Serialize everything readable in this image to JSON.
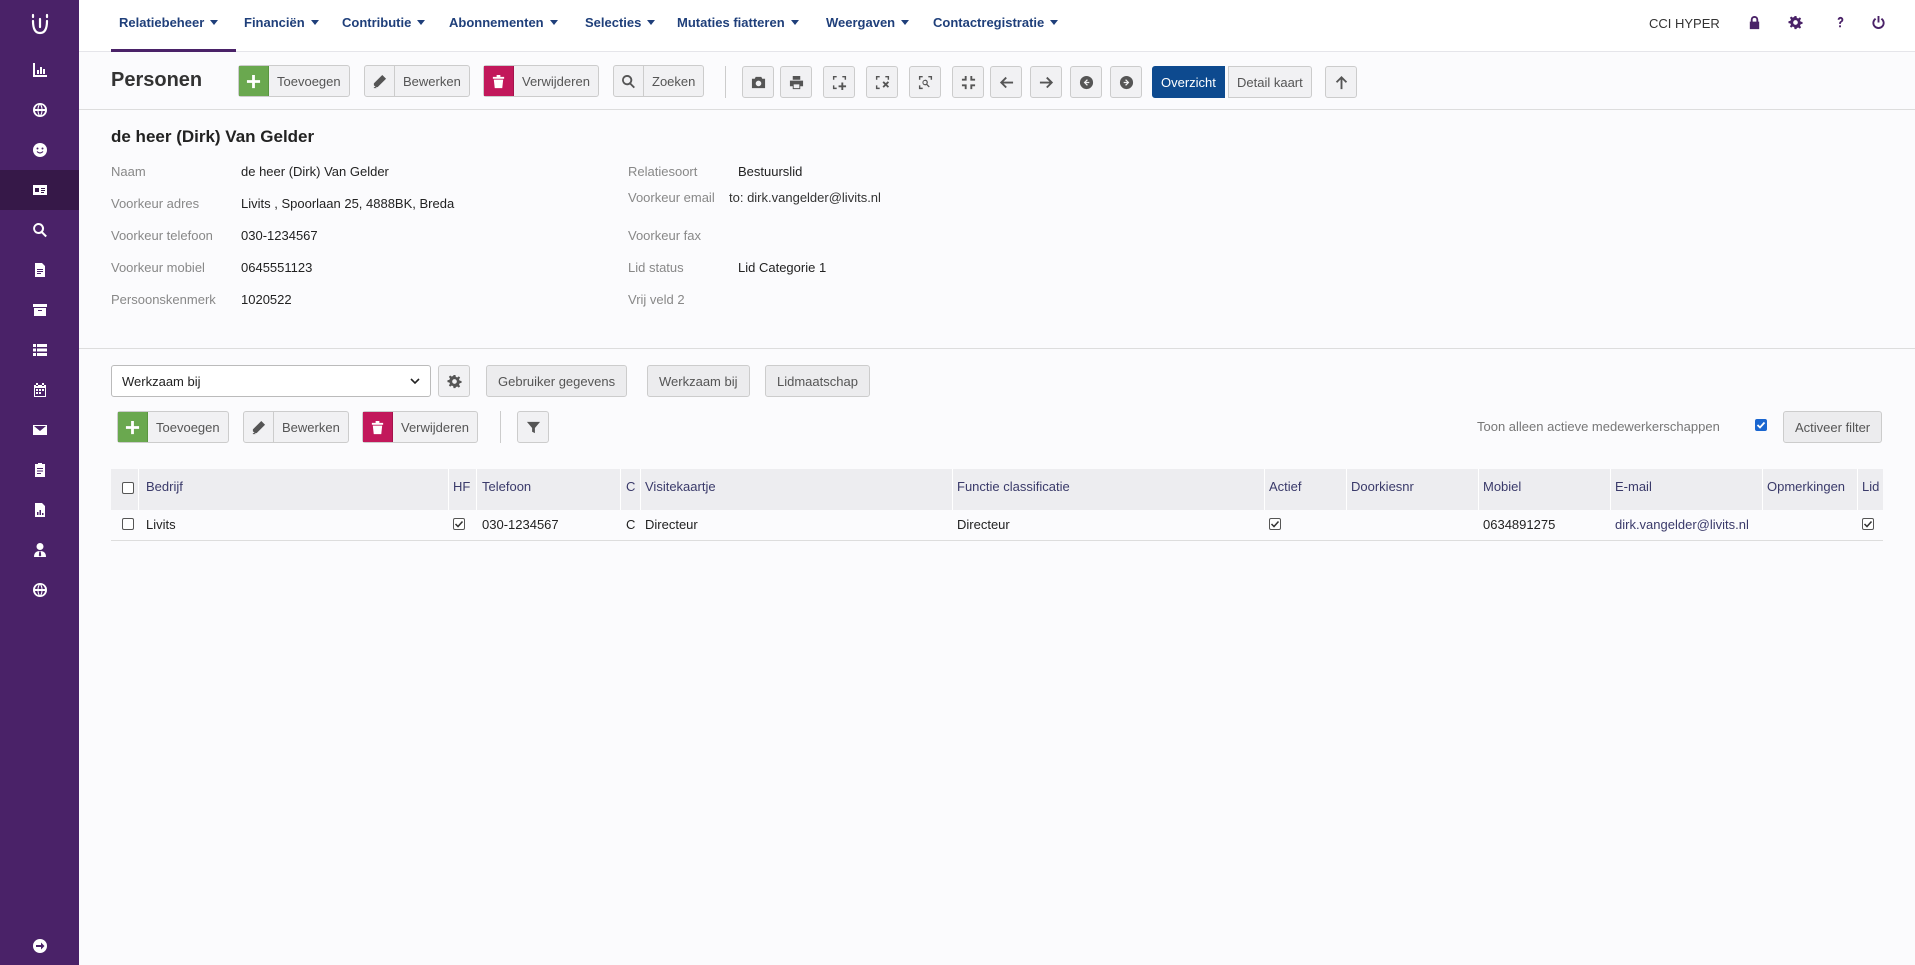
{
  "nav": {
    "menu": [
      {
        "label": "Relatiebeheer"
      },
      {
        "label": "Financiën"
      },
      {
        "label": "Contributie"
      },
      {
        "label": "Abonnementen"
      },
      {
        "label": "Selecties"
      },
      {
        "label": "Mutaties fiatteren"
      },
      {
        "label": "Weergaven"
      },
      {
        "label": "Contactregistratie"
      }
    ],
    "user": "CCI HYPER",
    "icons": [
      "lock-icon",
      "gear-icon",
      "help-icon",
      "power-icon"
    ]
  },
  "sidebar": {
    "icons": [
      "logo",
      "chart-icon",
      "globe-icon",
      "smiley-icon",
      "id-card-icon",
      "search-icon",
      "document-icon",
      "archive-icon",
      "list-icon",
      "calendar-icon",
      "envelope-icon",
      "clipboard-icon",
      "file-chart-icon",
      "user-tie-icon",
      "globe-icon",
      "logout-icon"
    ],
    "active": "id-card-icon"
  },
  "toolbar": {
    "title": "Personen",
    "add_label": "Toevoegen",
    "edit_label": "Bewerken",
    "delete_label": "Verwijderen",
    "search_label": "Zoeken",
    "view_overview": "Overzicht",
    "view_detail": "Detail kaart"
  },
  "detail": {
    "title": "de heer (Dirk) Van Gelder",
    "left": [
      {
        "label": "Naam",
        "value": "de heer (Dirk) Van Gelder"
      },
      {
        "label": "Voorkeur adres",
        "value": "Livits , Spoorlaan 25, 4888BK, Breda"
      },
      {
        "label": "Voorkeur telefoon",
        "value": "030-1234567"
      },
      {
        "label": "Voorkeur mobiel",
        "value": "0645551123"
      },
      {
        "label": "Persoonskenmerk",
        "value": "1020522"
      }
    ],
    "right": [
      {
        "label": "Relatiesoort",
        "value": "Bestuurslid"
      },
      {
        "label": "Voorkeur email",
        "value": "to: dirk.vangelder@livits.nl"
      },
      {
        "label": "Voorkeur fax",
        "value": ""
      },
      {
        "label": "Lid status",
        "value": "Lid Categorie 1"
      },
      {
        "label": "Vrij veld 2",
        "value": ""
      }
    ]
  },
  "sub": {
    "select_value": "Werkzaam bij",
    "tabs": [
      "Gebruiker gegevens",
      "Werkzaam bij",
      "Lidmaatschap"
    ],
    "add_label": "Toevoegen",
    "edit_label": "Bewerken",
    "delete_label": "Verwijderen",
    "filter_text": "Toon alleen actieve medewerkerschappen",
    "filter_checked": true,
    "activate_filter": "Activeer filter"
  },
  "table": {
    "columns": [
      "Bedrijf",
      "HF",
      "Telefoon",
      "C",
      "Visitekaartje",
      "Functie classificatie",
      "Actief",
      "Doorkiesnr",
      "Mobiel",
      "E-mail",
      "Opmerkingen",
      "Lid"
    ],
    "rows": [
      {
        "Bedrijf": "Livits",
        "HF": true,
        "Telefoon": "030-1234567",
        "C": "C",
        "Visitekaartje": "Directeur",
        "Functie classificatie": "Directeur",
        "Actief": true,
        "Doorkiesnr": "",
        "Mobiel": "0634891275",
        "E-mail": "dirk.vangelder@livits.nl",
        "Opmerkingen": "",
        "Lid": true
      }
    ]
  }
}
